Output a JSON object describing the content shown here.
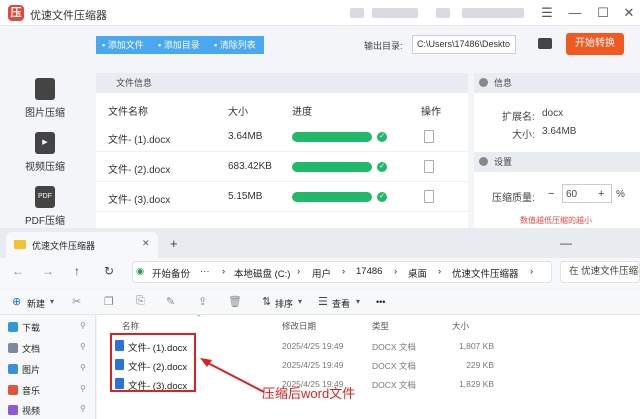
{
  "app": {
    "title": "优速文件压缩器",
    "nav": [
      "图片压缩",
      "视频压缩",
      "PDF压缩"
    ],
    "nav_icon_text": [
      "",
      "▶",
      "PDF"
    ],
    "toolbar": {
      "add_file": "添加文件",
      "add_dir": "添加目录",
      "clear": "清除列表"
    },
    "output_label": "输出目录:",
    "output_path": "C:\\Users\\17486\\Deskto",
    "start_button": "开始转换",
    "file_panel_title": "文件信息",
    "columns": {
      "name": "文件名称",
      "size": "大小",
      "progress": "进度",
      "action": "操作"
    },
    "files": [
      {
        "name": "文件- (1).docx",
        "size": "3.64MB",
        "progress": 1.0
      },
      {
        "name": "文件- (2).docx",
        "size": "683.42KB",
        "progress": 1.0
      },
      {
        "name": "文件- (3).docx",
        "size": "5.15MB",
        "progress": 1.0
      }
    ],
    "info": {
      "title": "信息",
      "ext_label": "扩展名:",
      "ext": "docx",
      "size_label": "大小:",
      "size": "3.64MB"
    },
    "settings": {
      "title": "设置",
      "quality_label": "压缩质量:",
      "quality": "60",
      "unit": "%",
      "minus": "−",
      "plus": "+",
      "hint": "数值越低压缩的越小"
    }
  },
  "explorer": {
    "tab_title": "优速文件压缩器",
    "tab_close": "✕",
    "new_tab": "+",
    "address": [
      "开始备份",
      "本地磁盘 (C:)",
      "用户",
      "17486",
      "桌面",
      "优速文件压缩器"
    ],
    "search": "在 优速文件压缩器",
    "commands": {
      "new": "新建",
      "sort": "排序",
      "view": "查看",
      "more": "•••"
    },
    "navpane": [
      {
        "label": "下载",
        "color": "#2b9ad6"
      },
      {
        "label": "文档",
        "color": "#7a8aa0"
      },
      {
        "label": "图片",
        "color": "#3a8fd8"
      },
      {
        "label": "音乐",
        "color": "#e0533b"
      },
      {
        "label": "视频",
        "color": "#8b5ad6"
      }
    ],
    "columns": {
      "name": "名称",
      "date": "修改日期",
      "type": "类型",
      "size": "大小"
    },
    "files": [
      {
        "name": "文件- (1).docx",
        "date": "2025/4/25 19:49",
        "type": "DOCX 文档",
        "size": "1,807 KB"
      },
      {
        "name": "文件- (2).docx",
        "date": "2025/4/25 19:49",
        "type": "DOCX 文档",
        "size": "229 KB"
      },
      {
        "name": "文件- (3).docx",
        "date": "2025/4/25 19:49",
        "type": "DOCX 文档",
        "size": "1,829 KB"
      }
    ]
  },
  "annotation": "压缩后word文件",
  "colors": {
    "accent": "#4aa8f0",
    "start": "#f05a22",
    "progress": "#1fb969",
    "annotation": "#e02020"
  }
}
